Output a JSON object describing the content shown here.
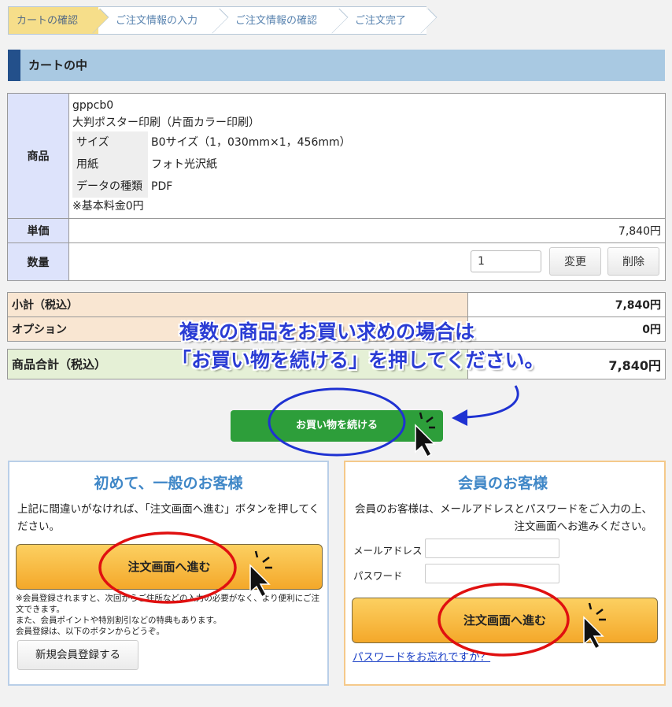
{
  "steps": [
    "カートの確認",
    "ご注文情報の入力",
    "ご注文情報の確認",
    "ご注文完了"
  ],
  "section_title": "カートの中",
  "cart": {
    "product_label": "商品",
    "product_code": "gppcb0",
    "product_name": "大判ポスター印刷（片面カラー印刷）",
    "specs": [
      {
        "key": "サイズ",
        "value": "B0サイズ（1，030mm×1，456mm）"
      },
      {
        "key": "用紙",
        "value": "フォト光沢紙"
      },
      {
        "key": "データの種類",
        "value": "PDF"
      }
    ],
    "base_fee_note": "※基本料金0円",
    "unit_price_label": "単価",
    "unit_price": "7,840円",
    "qty_label": "数量",
    "qty_value": "1",
    "change_button": "変更",
    "delete_button": "削除"
  },
  "subtotal": {
    "label": "小計（税込）",
    "value": "7,840円"
  },
  "option": {
    "label": "オプション",
    "value": "0円"
  },
  "total": {
    "label": "商品合計（税込）",
    "value": "7,840円"
  },
  "callout": {
    "line1": "複数の商品をお買い求めの場合は",
    "line2": "「お買い物を続ける」を押してください。"
  },
  "continue_button": "お買い物を続ける",
  "guest": {
    "title": "初めて、一般のお客様",
    "desc": "上記に間違いがなければ、「注文画面へ進む」ボタンを押してください。",
    "order_button": "注文画面へ進む",
    "note1": "※会員登録されますと、次回からご住所などの入力の必要がなく、より便利にご注文できます。",
    "note2": "また、会員ポイントや特別割引などの特典もあります。",
    "note3": "会員登録は、以下のボタンからどうぞ。",
    "register_button": "新規会員登録する"
  },
  "member": {
    "title": "会員のお客様",
    "desc": "会員のお客様は、メールアドレスとパスワードをご入力の上、注文画面へお進みください。",
    "email_label": "メールアドレス",
    "password_label": "パスワード",
    "order_button": "注文画面へ進む",
    "forgot_link": "パスワードをお忘れですか？"
  },
  "colors": {
    "accent": "#23508b",
    "continue": "#2d9e3a",
    "annotation_blue": "#2a3cd4",
    "annotation_red": "#e01010"
  }
}
